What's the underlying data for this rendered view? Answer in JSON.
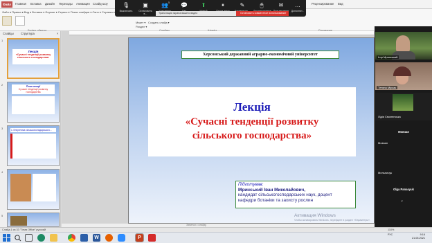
{
  "ribbon": {
    "file_tab": "Файл",
    "tabs": [
      "Главная",
      "Вставка",
      "Дизайн",
      "Переходы",
      "Анимация",
      "Слайд-шоу",
      "Рецензирование",
      "Вид",
      "Надстройки",
      "Справка"
    ],
    "menu_row": "Файл ▾  Правка ▾  Вид ▾  Вставка ▾  Формат ▾  Сервис ▾  Показ слайдов ▾  Окно ▾  Справка ▾",
    "font_label": "Макет ▾",
    "section_label": "Раздел ▾",
    "create_slide": "Создать слайд ▾",
    "sections": [
      "Буфер обмена",
      "Слайды",
      "Шрифт",
      "Абзац",
      "Рисование",
      "Редактирование"
    ]
  },
  "zoom_toolbar": {
    "items": [
      "Выключить",
      "Остановить в...",
      "Участники",
      "Чат",
      "Новый демонс...",
      "Пауза демо",
      "Комментир...",
      "Дистанционное у...",
      "Приглашения",
      "Дополнит..."
    ],
    "participants_count": "5",
    "banner": "Трансляция экрана вашего видео",
    "stop_share": "Остановить совместное использование"
  },
  "left_panel": {
    "tabs": [
      "Слайды",
      "Структура"
    ],
    "close_icon": "×",
    "thumbnails": [
      {
        "num": "1",
        "title": "Лекція",
        "subtitle": "«Сучасні тенденції розвитку сільського господарства»",
        "selected": true
      },
      {
        "num": "2",
        "title": "План лекції",
        "subtitle": "Сучасні тенденції розвитку господарства",
        "selected": false
      },
      {
        "num": "3",
        "title": "1. Енергетика сільськогосподарського…",
        "subtitle": "",
        "selected": false
      },
      {
        "num": "4",
        "title": "",
        "subtitle": "",
        "selected": false
      },
      {
        "num": "5",
        "title": "",
        "subtitle": "",
        "selected": false
      }
    ]
  },
  "slide": {
    "university": "Херсонський державний аграрно-економічний університет",
    "title": "Лекція",
    "topic_line1": "«Сучасні тенденції розвитку",
    "topic_line2": "сільського господарства»",
    "prepared_by": "Підготував:",
    "author_name": "Мринський Іван Миколайович,",
    "author_desc1": "кандидат сільськогосподарських наук, доцент",
    "author_desc2": "кафедри ботаніки та захисту рослин"
  },
  "notes": {
    "label": "Заметки к слайду"
  },
  "watermark": {
    "title": "Активация Windows",
    "subtitle": "Чтобы активировать Windows, перейдите в раздел «Параметры»."
  },
  "participants": {
    "video_tiles": [
      {
        "name": "Ігор Мринський"
      },
      {
        "name": "Тетяна Мірзак"
      },
      {
        "name": "Лідія Смоленська"
      }
    ],
    "name_only": [
      "Мовчан",
      "Мовчан",
      "Мельничук",
      "Olga Panasyuk"
    ]
  },
  "statusbar": {
    "left": "Слайд 1 из 33   \"Тема Office\"   русский",
    "zoom": "110%"
  },
  "taskbar": {
    "time": "9:16",
    "date": "21.05.2021",
    "lang": "РУС",
    "icons": [
      "windows-icon",
      "search-icon",
      "taskview-icon",
      "edge-icon",
      "folder-icon",
      "store-icon",
      "mail-icon",
      "word-icon",
      "chrome-icon",
      "zoom-icon",
      "powerpoint-icon",
      "excel-icon",
      "pdf-icon"
    ]
  },
  "colors": {
    "slide_title": "#1c1cb8",
    "slide_topic": "#d71a1a",
    "stop_share": "#d9352f",
    "file_tab": "#c0504d"
  }
}
